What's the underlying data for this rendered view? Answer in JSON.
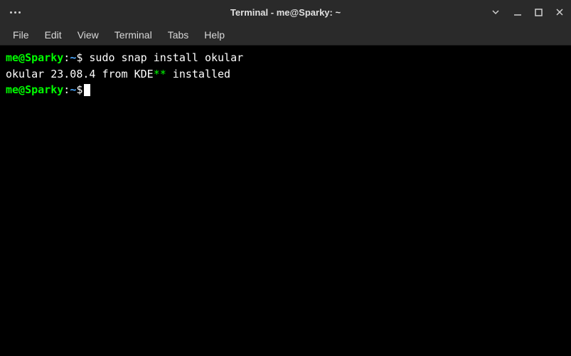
{
  "window": {
    "title": "Terminal - me@Sparky: ~"
  },
  "menu": {
    "file": "File",
    "edit": "Edit",
    "view": "View",
    "terminal": "Terminal",
    "tabs": "Tabs",
    "help": "Help"
  },
  "prompt": {
    "userhost": "me@Sparky",
    "colon": ":",
    "path": "~",
    "symbol": "$"
  },
  "lines": {
    "cmd1": " sudo snap install okular",
    "out1_a": "okular 23.08.4 from KDE",
    "out1_b": "**",
    "out1_c": " installed"
  }
}
